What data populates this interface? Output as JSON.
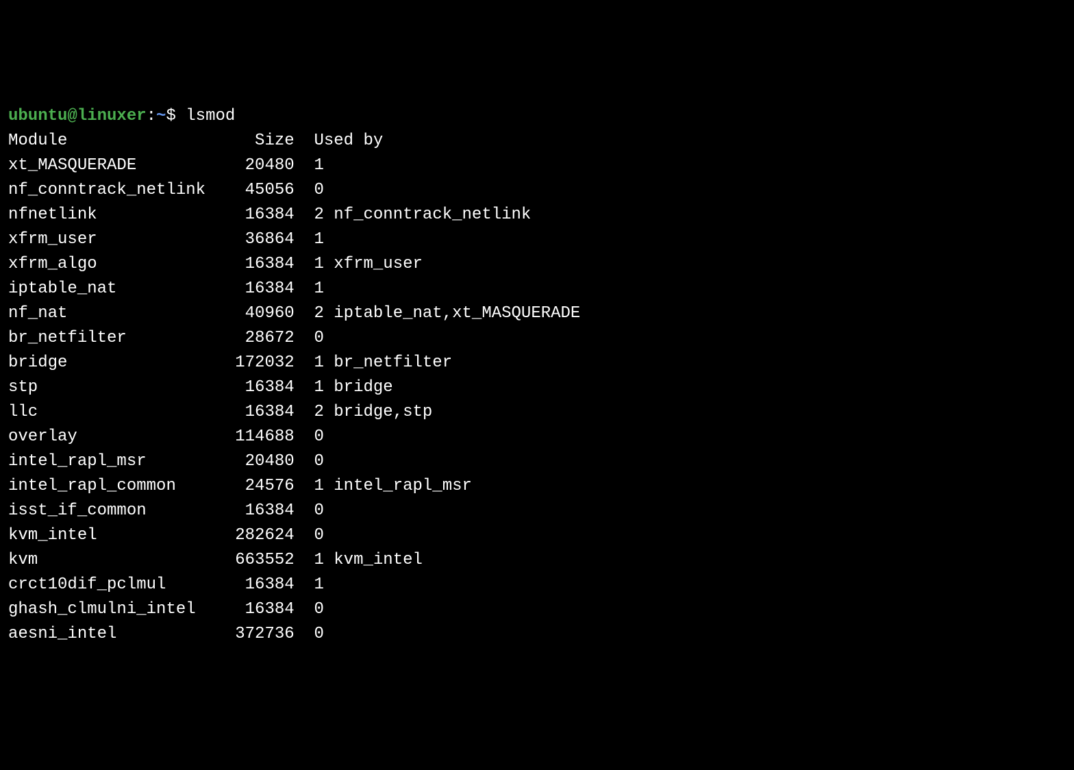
{
  "prompt": {
    "user": "ubuntu@linuxer",
    "colon": ":",
    "path": "~",
    "dollar": "$",
    "command": "lsmod"
  },
  "header": {
    "module": "Module",
    "size": "Size",
    "usedby": "Used by"
  },
  "modules": [
    {
      "name": "xt_MASQUERADE",
      "size": "20480",
      "used": "1",
      "by": ""
    },
    {
      "name": "nf_conntrack_netlink",
      "size": "45056",
      "used": "0",
      "by": ""
    },
    {
      "name": "nfnetlink",
      "size": "16384",
      "used": "2",
      "by": "nf_conntrack_netlink"
    },
    {
      "name": "xfrm_user",
      "size": "36864",
      "used": "1",
      "by": ""
    },
    {
      "name": "xfrm_algo",
      "size": "16384",
      "used": "1",
      "by": "xfrm_user"
    },
    {
      "name": "iptable_nat",
      "size": "16384",
      "used": "1",
      "by": ""
    },
    {
      "name": "nf_nat",
      "size": "40960",
      "used": "2",
      "by": "iptable_nat,xt_MASQUERADE"
    },
    {
      "name": "br_netfilter",
      "size": "28672",
      "used": "0",
      "by": ""
    },
    {
      "name": "bridge",
      "size": "172032",
      "used": "1",
      "by": "br_netfilter"
    },
    {
      "name": "stp",
      "size": "16384",
      "used": "1",
      "by": "bridge"
    },
    {
      "name": "llc",
      "size": "16384",
      "used": "2",
      "by": "bridge,stp"
    },
    {
      "name": "overlay",
      "size": "114688",
      "used": "0",
      "by": ""
    },
    {
      "name": "intel_rapl_msr",
      "size": "20480",
      "used": "0",
      "by": ""
    },
    {
      "name": "intel_rapl_common",
      "size": "24576",
      "used": "1",
      "by": "intel_rapl_msr"
    },
    {
      "name": "isst_if_common",
      "size": "16384",
      "used": "0",
      "by": ""
    },
    {
      "name": "kvm_intel",
      "size": "282624",
      "used": "0",
      "by": ""
    },
    {
      "name": "kvm",
      "size": "663552",
      "used": "1",
      "by": "kvm_intel"
    },
    {
      "name": "crct10dif_pclmul",
      "size": "16384",
      "used": "1",
      "by": ""
    },
    {
      "name": "ghash_clmulni_intel",
      "size": "16384",
      "used": "0",
      "by": ""
    },
    {
      "name": "aesni_intel",
      "size": "372736",
      "used": "0",
      "by": ""
    }
  ]
}
